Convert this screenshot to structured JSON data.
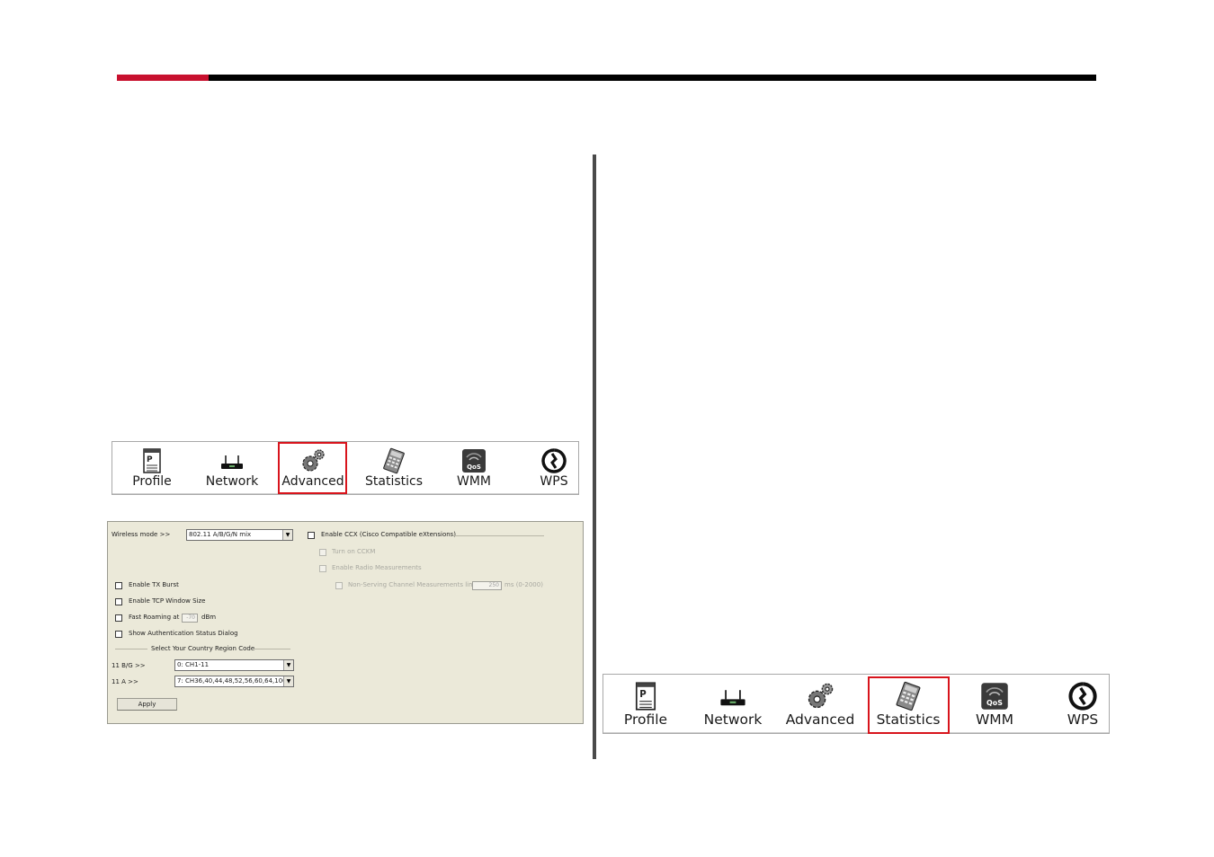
{
  "colors": {
    "accent_red": "#c8102e",
    "bar_black": "#000000",
    "highlight": "#d8141c",
    "panel_bg": "#ebe9d9"
  },
  "toolbar": {
    "items": [
      {
        "label": "Profile",
        "icon": "profile-icon"
      },
      {
        "label": "Network",
        "icon": "router-icon"
      },
      {
        "label": "Advanced",
        "icon": "gears-icon"
      },
      {
        "label": "Statistics",
        "icon": "calculator-icon"
      },
      {
        "label": "WMM",
        "icon": "qos-icon"
      },
      {
        "label": "WPS",
        "icon": "wps-icon"
      }
    ],
    "left_selected": "Advanced",
    "right_selected": "Statistics"
  },
  "advanced": {
    "wireless_mode_label": "Wireless mode >>",
    "wireless_mode_value": "802.11 A/B/G/N mix",
    "enable_tx_burst": "Enable TX Burst",
    "enable_tcp_window": "Enable TCP Window Size",
    "fast_roaming": "Fast Roaming at",
    "fast_roaming_value": "-70",
    "fast_roaming_unit": "dBm",
    "show_auth_dialog": "Show Authentication Status Dialog",
    "country_region_title": "Select Your Country Region Code",
    "bg_label": "11 B/G >>",
    "bg_value": "0: CH1-11",
    "a_label": "11 A >>",
    "a_value": "7: CH36,40,44,48,52,56,60,64,100",
    "enable_ccx": "Enable CCX (Cisco Compatible eXtensions)",
    "turn_on_ccxx": "Turn on CCKM",
    "enable_radio_measurements": "Enable Radio Measurements",
    "non_serving": "Non-Serving Channel Measurements limit",
    "non_serving_value": "250",
    "non_serving_unit": "ms (0-2000)",
    "apply": "Apply"
  }
}
